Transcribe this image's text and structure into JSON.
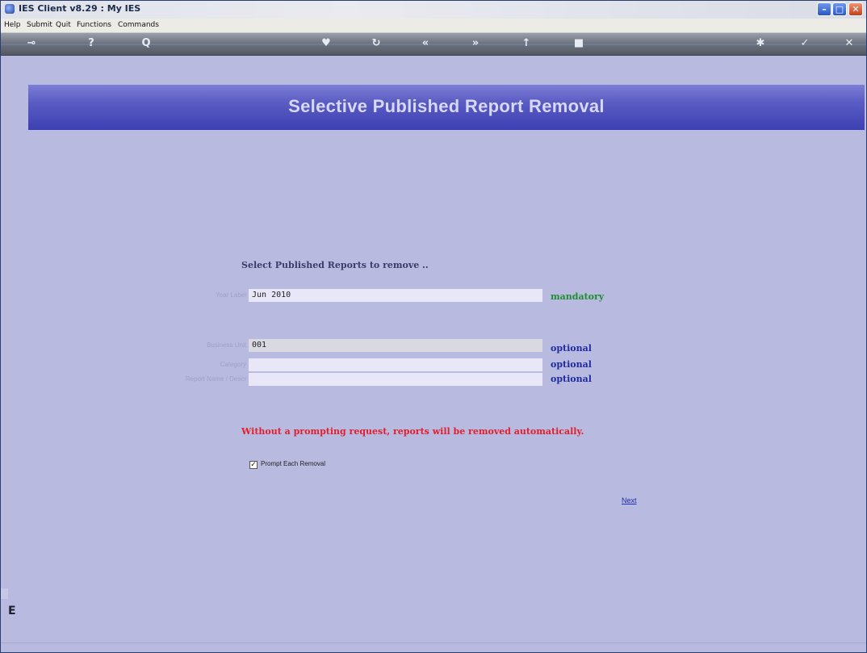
{
  "window": {
    "title": "IES Client v8.29 : My IES",
    "controls": {
      "minimize": "–",
      "maximize": "□",
      "close": "✕"
    }
  },
  "menu": [
    "Help",
    "Submit",
    "Quit",
    "Functions",
    "Commands"
  ],
  "toolbar": {
    "icons": [
      "key-icon",
      "help-icon",
      "search-icon",
      "heart-icon",
      "refresh-icon",
      "rewind-icon",
      "forward-icon",
      "up-icon",
      "stop-icon",
      "settings-icon",
      "ok-icon",
      "close-icon"
    ],
    "glyphs": [
      "⊸",
      "?",
      "Q",
      "♥",
      "↻",
      "«",
      "»",
      "↑",
      "■",
      "✱",
      "✓",
      "✕"
    ]
  },
  "banner": {
    "title": "Selective Published Report Removal"
  },
  "form": {
    "heading": "Select Published Reports to remove ..",
    "fields": [
      {
        "label": "Year Label",
        "value": "Jun 2010",
        "tag": "mandatory"
      },
      {
        "label": "Business Unit",
        "value": "001",
        "tag": "optional"
      },
      {
        "label": "Category",
        "value": "",
        "tag": "optional"
      },
      {
        "label": "Report Name / Descr",
        "value": "",
        "tag": "optional"
      }
    ],
    "warning": "Without a prompting request, reports will be removed automatically.",
    "checkbox": {
      "label": "Prompt Each Removal",
      "checked": true,
      "mark": "✓"
    },
    "next_label": "Next"
  },
  "sidebar": {
    "letter": "E"
  },
  "colors": {
    "banner": "#5a5bc2",
    "background": "#b9badf",
    "mandatory": "#1e8f2e",
    "optional": "#1f2b9f",
    "warning": "#e0202f"
  }
}
